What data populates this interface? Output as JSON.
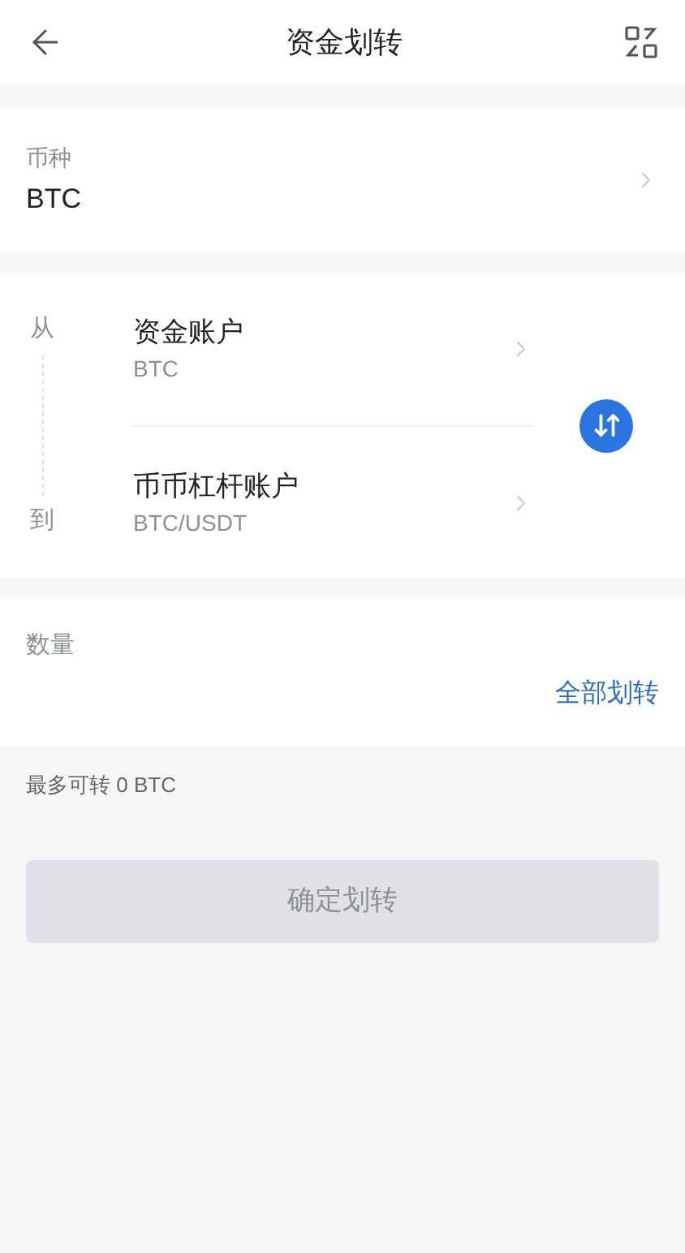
{
  "header": {
    "title": "资金划转"
  },
  "coin": {
    "label": "币种",
    "value": "BTC"
  },
  "transfer": {
    "from": {
      "label": "从",
      "account": "资金账户",
      "currency": "BTC"
    },
    "to": {
      "label": "到",
      "account": "币币杠杆账户",
      "currency": "BTC/USDT"
    }
  },
  "amount": {
    "label": "数量",
    "all_button": "全部划转"
  },
  "max_note": "最多可转 0 BTC",
  "confirm": {
    "label": "确定划转",
    "disabled": true
  }
}
